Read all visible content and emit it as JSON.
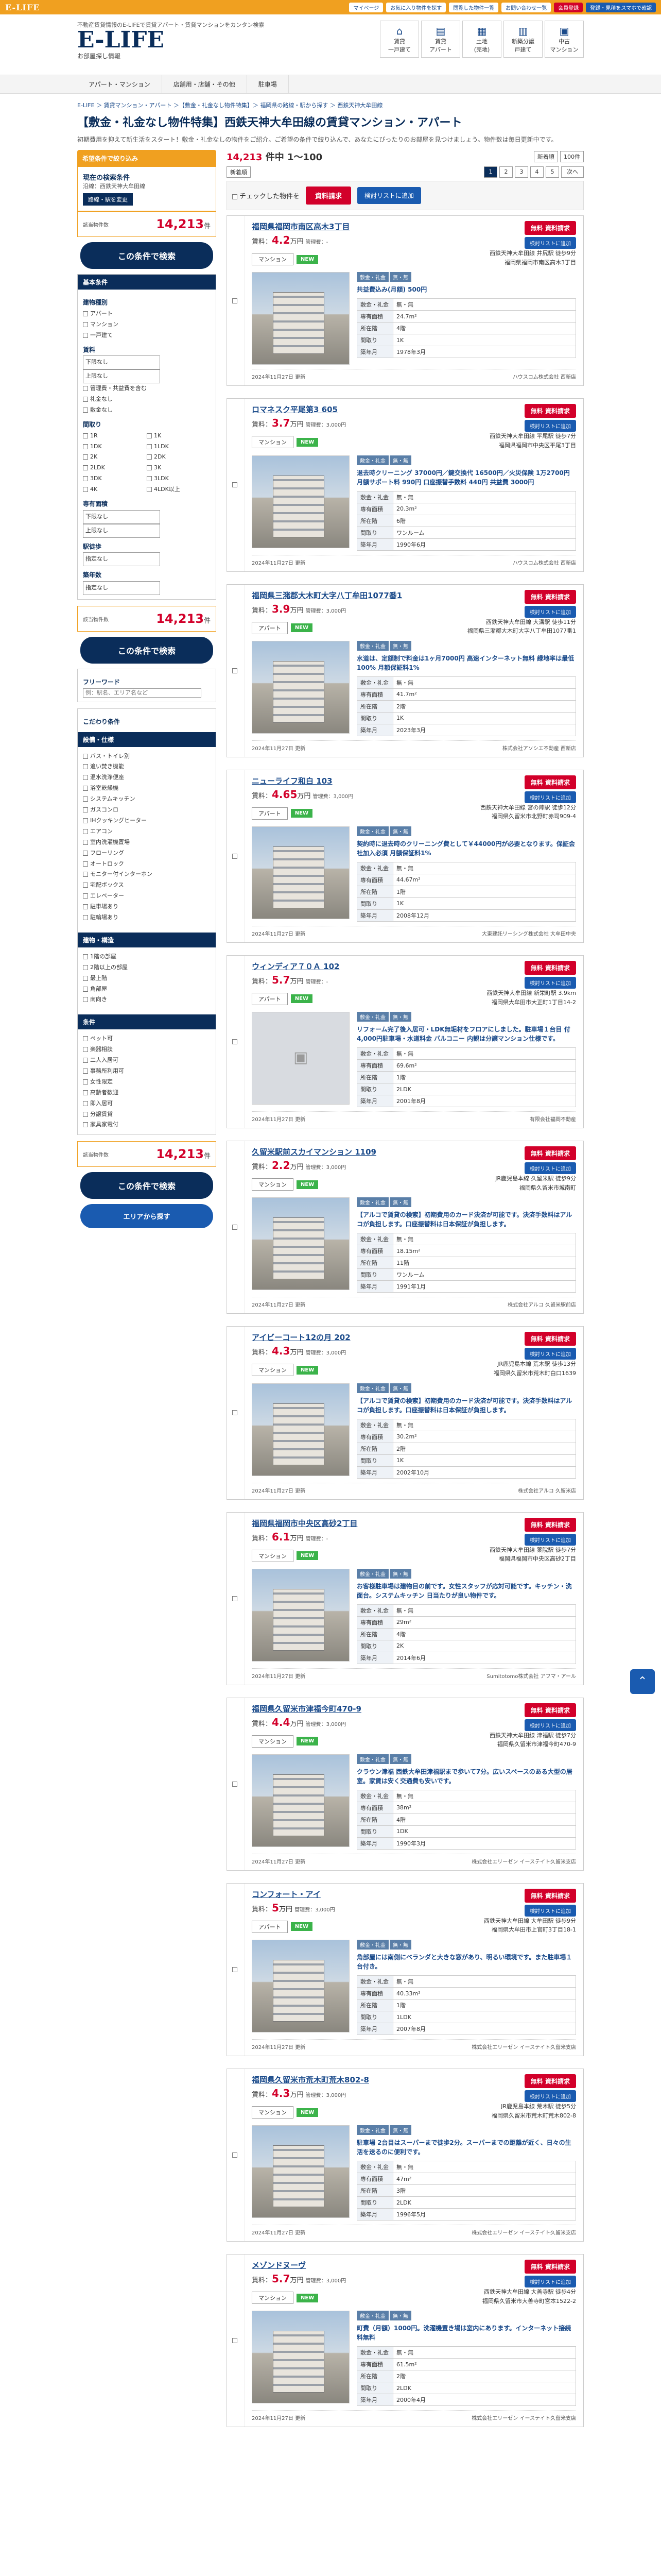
{
  "topbar": {
    "logo": "E-LIFE",
    "links": [
      "マイページ",
      "お気に入り物件を探す",
      "閲覧した物件一覧",
      "お問い合わせ一覧"
    ],
    "red": "会員登録",
    "blue": "登録・見積をスマホで確認"
  },
  "header": {
    "tagline": "不動産賃貸情報のE-LIFEで賃貸アパート・賃貸マンションをカンタン検索",
    "logo": "E-LIFE",
    "logo_sub": "お部屋探し情報",
    "nav": [
      {
        "icon": "⌂",
        "label": "賃貸\n一戸建て"
      },
      {
        "icon": "▤",
        "label": "賃貸\nアパート"
      },
      {
        "icon": "▦",
        "label": "土地\n(売地)"
      },
      {
        "icon": "▥",
        "label": "新築分譲\n戸建て"
      },
      {
        "icon": "▣",
        "label": "中古\nマンション"
      }
    ]
  },
  "gnav": [
    "アパート・マンション",
    "店舗用・店舗・その他",
    "駐車場"
  ],
  "breadcrumb": "E-LIFE ＞ 賃貸マンション・アパート ＞【敷金・礼金なし物件特集】＞ 福岡県の路線・駅から探す ＞ 西鉄天神大牟田線",
  "page_title": "【敷金・礼金なし物件特集】西鉄天神大牟田線の賃貸マンション・アパート",
  "page_desc": "初期費用を抑えて新生活をスタート！敷金・礼金なしの物件をご紹介。ご希望の条件で絞り込んで、あなたにぴったりのお部屋を見つけましょう。物件数は毎日更新中です。",
  "side": {
    "search_head": "希望条件で絞り込み",
    "current_label": "現在の検索条件",
    "current_val": "沿線：西鉄天神大牟田線",
    "edit_btn": "路線・駅を変更",
    "count": "14,213",
    "count_unit": "件",
    "count_label": "該当物件数",
    "search_btn": "この条件で検索",
    "basic_head": "基本条件",
    "kind_label": "建物種別",
    "kinds": [
      "アパート",
      "マンション",
      "一戸建て"
    ],
    "rent_label": "賃料",
    "rent_min": "下限なし",
    "rent_max": "上限なし",
    "rent_opts": [
      "管理費・共益費を含む",
      "礼金なし",
      "敷金なし"
    ],
    "madori_label": "間取り",
    "madori": [
      "1R",
      "1K",
      "1DK",
      "1LDK",
      "2K",
      "2DK",
      "2LDK",
      "3K",
      "3DK",
      "3LDK",
      "4K",
      "4LDK以上"
    ],
    "area_label": "専有面積",
    "area_min": "下限なし",
    "area_max": "上限なし",
    "walk_label": "駅徒歩",
    "walk": "指定なし",
    "age_label": "築年数",
    "age": "指定なし",
    "free_head": "フリーワード",
    "free_placeholder": "例：駅名、エリア名など",
    "kodawari_head": "こだわり条件",
    "sec1": "設備・仕様",
    "sec1_items": [
      "バス・トイレ別",
      "追い焚き機能",
      "温水洗浄便座",
      "浴室乾燥機",
      "システムキッチン",
      "ガスコンロ",
      "IHクッキングヒーター",
      "エアコン",
      "室内洗濯機置場",
      "フローリング",
      "オートロック",
      "モニター付インターホン",
      "宅配ボックス",
      "エレベーター",
      "駐車場あり",
      "駐輪場あり"
    ],
    "sec2": "建物・構造",
    "sec2_items": [
      "1階の部屋",
      "2階以上の部屋",
      "最上階",
      "角部屋",
      "南向き"
    ],
    "sec3": "条件",
    "sec3_items": [
      "ペット可",
      "楽器相談",
      "二人入居可",
      "事務所利用可",
      "女性限定",
      "高齢者歓迎",
      "即入居可",
      "分譲賃貸",
      "家具家電付"
    ],
    "bottom_count": "14,213",
    "bottom_btn": "この条件で検索",
    "save_btn": "エリアから探す"
  },
  "list": {
    "total": "14,213",
    "range": "1〜100",
    "sort": "新着順",
    "per_page": "100件",
    "pages": [
      "1",
      "2",
      "3",
      "4",
      "5",
      "次へ"
    ],
    "bulk_check": "チェックした物件を",
    "bulk_red": "資料請求",
    "bulk_blue": "検討リストに追加"
  },
  "cards": [
    {
      "name": "福岡県福岡市南区高木3丁目",
      "rent": "4.2",
      "unit": "万円",
      "fee": "管理費：-",
      "type": "マンション",
      "new": "NEW",
      "line": "西鉄天神大牟田線 井尻駅 徒歩9分",
      "addr": "福岡県福岡市南区高木3丁目",
      "pr": "共益費込み(月額) 500円",
      "layout": "1K",
      "area": "24.7m²",
      "floor": "4階",
      "built": "1978年3月",
      "date": "2024年11月27日 更新",
      "company": "ハウスコム株式会社 西新店",
      "photo": true
    },
    {
      "name": "ロマネスク平尾第3 605",
      "rent": "3.7",
      "unit": "万円",
      "fee": "管理費：3,000円",
      "type": "マンション",
      "new": "NEW",
      "line": "西鉄天神大牟田線 平尾駅 徒歩7分",
      "addr": "福岡県福岡市中央区平尾3丁目",
      "pr": "退去時クリーニング 37000円／鍵交換代 16500円／火災保険 1万2700円 月額サポート料 990円 口座振替手数料 440円 共益費 3000円",
      "layout": "ワンルーム",
      "area": "20.3m²",
      "floor": "6階",
      "built": "1990年6月",
      "date": "2024年11月27日 更新",
      "company": "ハウスコム株式会社 西新店",
      "photo": true
    },
    {
      "name": "福岡県三潴郡大木町大字八丁牟田1077番1",
      "rent": "3.9",
      "unit": "万円",
      "fee": "管理費：3,000円",
      "type": "アパート",
      "new": "NEW",
      "line": "西鉄天神大牟田線 大溝駅 徒歩11分",
      "addr": "福岡県三潴郡大木町大字八丁牟田1077番1",
      "pr": "水道は、定額制で料金は1ヶ月7000円 高速インターネット無料 緑地率は最低100% 月額保証料1%",
      "layout": "1K",
      "area": "41.7m²",
      "floor": "2階",
      "built": "2023年3月",
      "date": "2024年11月27日 更新",
      "company": "株式会社アソシエ不動産 西新店",
      "photo": true
    },
    {
      "name": "ニューライフ和白 103",
      "rent": "4.65",
      "unit": "万円",
      "fee": "管理費：3,000円",
      "type": "アパート",
      "new": "NEW",
      "line": "西鉄天神大牟田線 宮の陣駅 徒歩12分",
      "addr": "福岡県久留米市北野町赤司909-4",
      "pr": "契約時に退去時のクリーニング費として￥44000円が必要となります。保証会社加入必須 月額保証料1%",
      "layout": "1K",
      "area": "44.67m²",
      "floor": "1階",
      "built": "2008年12月",
      "date": "2024年11月27日 更新",
      "company": "大東建託リーシング株式会社 大牟田中央",
      "photo": true
    },
    {
      "name": "ウィンディア７０Ａ 102",
      "rent": "5.7",
      "unit": "万円",
      "fee": "管理費：-",
      "type": "アパート",
      "new": "NEW",
      "line": "西鉄天神大牟田線 新栄町駅 3.9km",
      "addr": "福岡県大牟田市大正町1丁目14-2",
      "pr": "リフォーム完了後入居可・LDK無垢材をフロアにしました。駐車場１台目 付 4,000円駐車場・水道料金 バルコニー 内観は分譲マンション仕様です。",
      "layout": "2LDK",
      "area": "69.6m²",
      "floor": "1階",
      "built": "2001年8月",
      "date": "2024年11月27日 更新",
      "company": "有限会社福岡不動産",
      "photo": false
    },
    {
      "name": "久留米駅前スカイマンション 1109",
      "rent": "2.2",
      "unit": "万円",
      "fee": "管理費：3,000円",
      "type": "マンション",
      "new": "NEW",
      "line": "JR鹿児島本線 久留米駅 徒歩9分",
      "addr": "福岡県久留米市城南町",
      "pr": "【アルコで賃貸の検索】初期費用のカード決済が可能です。決済手数料はアルコが負担します。口座振替料は日本保証が負担します。",
      "layout": "ワンルーム",
      "area": "18.15m²",
      "floor": "11階",
      "built": "1991年1月",
      "date": "2024年11月27日 更新",
      "company": "株式会社アルコ 久留米駅前店",
      "photo": true
    },
    {
      "name": "アイビーコート12の月 202",
      "rent": "4.3",
      "unit": "万円",
      "fee": "管理費：3,000円",
      "type": "マンション",
      "new": "NEW",
      "line": "JR鹿児島本線 荒木駅 徒歩13分",
      "addr": "福岡県久留米市荒木町白口1639",
      "pr": "【アルコで賃貸の検索】初期費用のカード決済が可能です。決済手数料はアルコが負担します。口座振替料は日本保証が負担します。",
      "layout": "1K",
      "area": "30.2m²",
      "floor": "2階",
      "built": "2002年10月",
      "date": "2024年11月27日 更新",
      "company": "株式会社アルコ 久留米店",
      "photo": true
    },
    {
      "name": "福岡県福岡市中央区高砂2丁目",
      "rent": "6.1",
      "unit": "万円",
      "fee": "管理費：-",
      "type": "マンション",
      "new": "NEW",
      "line": "西鉄天神大牟田線 薬院駅 徒歩7分",
      "addr": "福岡県福岡市中央区高砂2丁目",
      "pr": "お客様駐車場は建物目の前です。女性スタッフが応対可能です。キッチン・洗面台。システムキッチン 日当たりが良い物件です。",
      "layout": "2K",
      "area": "29m²",
      "floor": "4階",
      "built": "2014年6月",
      "date": "2024年11月27日 更新",
      "company": "Sumitotomo株式会社 アフマ・アール",
      "photo": true
    },
    {
      "name": "福岡県久留米市津福今町470-9",
      "rent": "4.4",
      "unit": "万円",
      "fee": "管理費：3,000円",
      "type": "マンション",
      "new": "NEW",
      "line": "西鉄天神大牟田線 津福駅 徒歩7分",
      "addr": "福岡県久留米市津福今町470-9",
      "pr": "クラウン津福 西鉄大牟田津福駅まで歩いて7分。広いスペースのある大型の居室。家賃は安く交通費も安いです。",
      "layout": "1DK",
      "area": "38m²",
      "floor": "4階",
      "built": "1990年3月",
      "date": "2024年11月27日 更新",
      "company": "株式会社エリーゼン イーステイト久留米支店",
      "photo": true
    },
    {
      "name": "コンフォート・アイ",
      "rent": "5",
      "unit": "万円",
      "fee": "管理費：3,000円",
      "type": "アパート",
      "new": "NEW",
      "line": "西鉄天神大牟田線 大牟田駅 徒歩9分",
      "addr": "福岡県大牟田市上官町3丁目18-1",
      "pr": "角部屋には南側にベランダと大きな窓があり、明るい環境です。また駐車場１台付き。",
      "layout": "1LDK",
      "area": "40.33m²",
      "floor": "1階",
      "built": "2007年8月",
      "date": "2024年11月27日 更新",
      "company": "株式会社エリーゼン イーステイト久留米支店",
      "photo": true
    },
    {
      "name": "福岡県久留米市荒木町荒木802-8",
      "rent": "4.3",
      "unit": "万円",
      "fee": "管理費：3,000円",
      "type": "マンション",
      "new": "NEW",
      "line": "JR鹿児島本線 荒木駅 徒歩5分",
      "addr": "福岡県久留米市荒木町荒木802-8",
      "pr": "駐車場 2台目はスーパーまで徒歩2分。スーパーまでの距離が近く、日々の生活を送るのに便利です。",
      "layout": "2LDK",
      "area": "47m²",
      "floor": "3階",
      "built": "1996年5月",
      "date": "2024年11月27日 更新",
      "company": "株式会社エリーゼン イーステイト久留米支店",
      "photo": true
    },
    {
      "name": "メゾンドヌーヴ",
      "rent": "5.7",
      "unit": "万円",
      "fee": "管理費：3,000円",
      "type": "マンション",
      "new": "NEW",
      "line": "西鉄天神大牟田線 大善寺駅 徒歩4分",
      "addr": "福岡県久留米市大善寺町宮本1522-2",
      "pr": "町費（月額）1000円。洗濯機置き場は室内にあります。インターネット接続料無料",
      "layout": "2LDK",
      "area": "61.5m²",
      "floor": "2階",
      "built": "2000年4月",
      "date": "2024年11月27日 更新",
      "company": "株式会社エリーゼン イーステイト久留米支店",
      "photo": true
    }
  ],
  "card_labels": {
    "layout": "間取り",
    "area": "専有面積",
    "floor": "所在階",
    "built": "築年月",
    "deposit": "敷金・礼金",
    "deposit_val": "無・無",
    "req": "資料請求",
    "req_free": "無料",
    "fav": "検討リストに追加",
    "rent_label": "賃料："
  }
}
